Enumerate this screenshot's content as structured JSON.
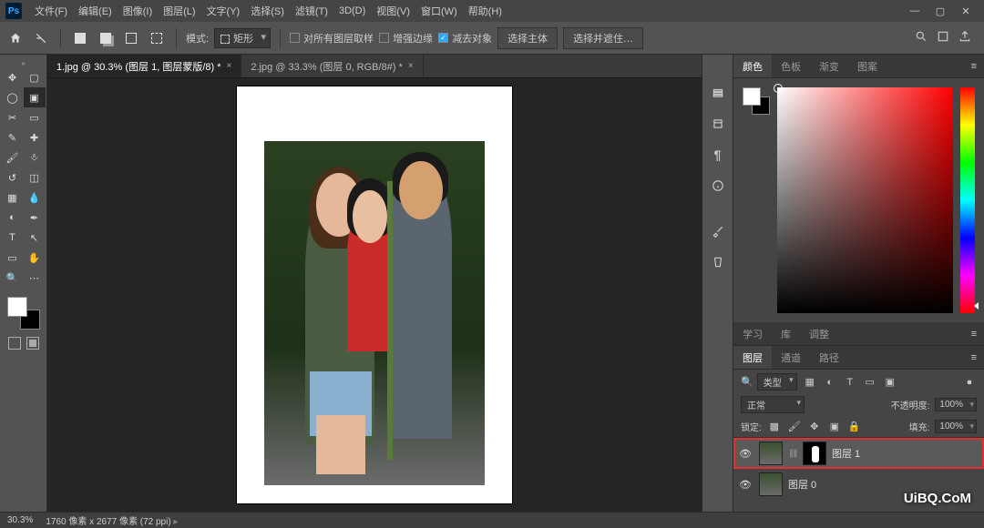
{
  "menu": {
    "items": [
      "文件(F)",
      "编辑(E)",
      "图像(I)",
      "图层(L)",
      "文字(Y)",
      "选择(S)",
      "滤镜(T)",
      "3D(D)",
      "视图(V)",
      "窗口(W)",
      "帮助(H)"
    ]
  },
  "options": {
    "mode_label": "模式:",
    "shape_dropdown": "矩形",
    "chk_all_layers": "对所有图层取样",
    "chk_enhance_edge": "增强边缘",
    "chk_subtract": "减去对象",
    "btn_select_subject": "选择主体",
    "btn_select_mask": "选择并遮住…"
  },
  "tabs": {
    "t1": "1.jpg @ 30.3% (图层 1, 图层蒙版/8) *",
    "t2": "2.jpg @ 33.3% (图层 0, RGB/8#) *"
  },
  "right_top_tabs": [
    "颜色",
    "色板",
    "渐变",
    "图案"
  ],
  "mid_tabs": [
    "学习",
    "库",
    "调整"
  ],
  "layer_tabs": [
    "图层",
    "通道",
    "路径"
  ],
  "layers": {
    "filter_label": "类型",
    "blend_mode": "正常",
    "opacity_label": "不透明度:",
    "opacity_value": "100%",
    "lock_label": "锁定:",
    "fill_label": "填充:",
    "fill_value": "100%",
    "row1_name": "图层 1",
    "row2_name": "图层 0"
  },
  "status": {
    "zoom": "30.3%",
    "dims": "1760 像素 x 2677 像素 (72 ppi)"
  },
  "watermark": "UiBQ.CoM"
}
